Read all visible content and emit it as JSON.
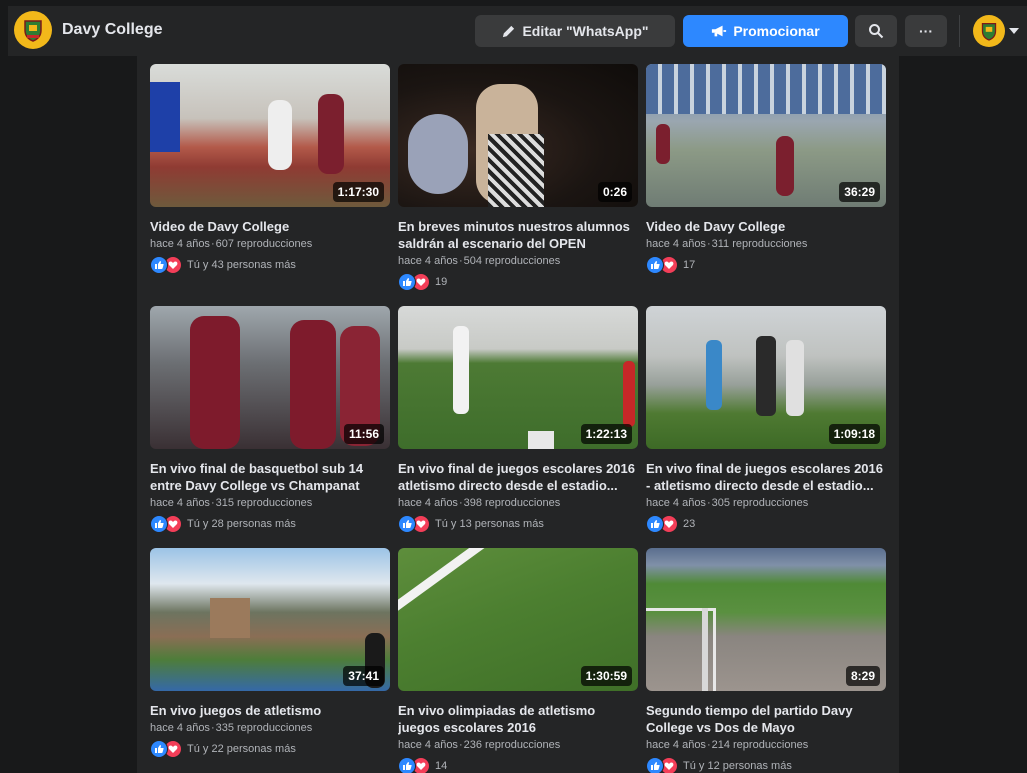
{
  "header": {
    "page_name": "Davy College",
    "edit_label": "Editar \"WhatsApp\"",
    "promote_label": "Promocionar",
    "more_label": "···"
  },
  "colors": {
    "accent": "#2d88ff",
    "background": "#18191a",
    "surface": "#242526",
    "button": "#3a3b3c",
    "love": "#f33e58",
    "avatar": "#f2b81a"
  },
  "videos": [
    {
      "title": "Video de Davy College",
      "duration": "1:17:30",
      "age": "hace 4 años",
      "views": "607 reproducciones",
      "reactions": "Tú y 43 personas más"
    },
    {
      "title": "En breves minutos nuestros alumnos saldrán al escenario del OPEN PLAZA...",
      "duration": "0:26",
      "age": "hace 4 años",
      "views": "504 reproducciones",
      "reactions": "19"
    },
    {
      "title": "Video de Davy College",
      "duration": "36:29",
      "age": "hace 4 años",
      "views": "311 reproducciones",
      "reactions": "17"
    },
    {
      "title": "En vivo final de basquetbol sub 14 entre Davy College vs Champanat",
      "duration": "11:56",
      "age": "hace 4 años",
      "views": "315 reproducciones",
      "reactions": "Tú y 28 personas más"
    },
    {
      "title": "En vivo final de juegos escolares 2016 atletismo directo desde el estadio...",
      "duration": "1:22:13",
      "age": "hace 4 años",
      "views": "398 reproducciones",
      "reactions": "Tú y 13 personas más"
    },
    {
      "title": "En vivo final de juegos escolares 2016 - atletismo directo desde el estadio...",
      "duration": "1:09:18",
      "age": "hace 4 años",
      "views": "305 reproducciones",
      "reactions": "23"
    },
    {
      "title": "En vivo juegos de atletismo",
      "duration": "37:41",
      "age": "hace 4 años",
      "views": "335 reproducciones",
      "reactions": "Tú y 22 personas más"
    },
    {
      "title": "En vivo olimpiadas de atletismo juegos escolares 2016",
      "duration": "1:30:59",
      "age": "hace 4 años",
      "views": "236 reproducciones",
      "reactions": "14"
    },
    {
      "title": "Segundo tiempo del partido Davy College vs Dos de Mayo",
      "duration": "8:29",
      "age": "hace 4 años",
      "views": "214 reproducciones",
      "reactions": "Tú y 12 personas más"
    }
  ]
}
